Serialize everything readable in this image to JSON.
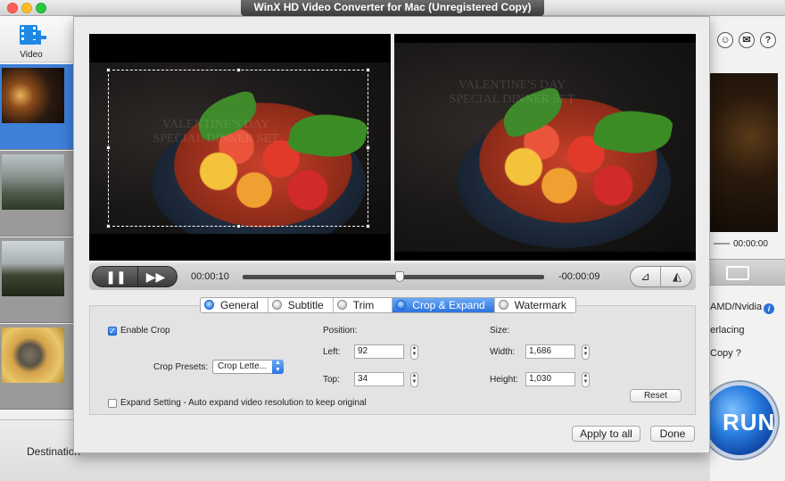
{
  "window": {
    "title": "WinX HD Video Converter for Mac (Unregistered Copy)"
  },
  "sidebar": {
    "video_label": "Video"
  },
  "right_panel": {
    "time": "00:00:00",
    "hw_label": "AMD/Nvidia",
    "deinterlace_label": "erlacing",
    "copy_label": "Copy ?",
    "run_label": "RUN"
  },
  "bottom": {
    "destination_label": "Destination"
  },
  "preview": {
    "watermark_line1": "VALENTINE'S DAY",
    "watermark_line2": "SPECIAL DINNER SET"
  },
  "playback": {
    "current_time": "00:00:10",
    "remaining_time": "-00:00:09",
    "progress": 0.52
  },
  "tabs": [
    {
      "label": "General",
      "active": false
    },
    {
      "label": "Subtitle",
      "active": false
    },
    {
      "label": "Trim",
      "active": false
    },
    {
      "label": "Crop & Expand",
      "active": true
    },
    {
      "label": "Watermark",
      "active": false
    }
  ],
  "crop": {
    "enable_label": "Enable Crop",
    "enabled": true,
    "presets_label": "Crop Presets:",
    "preset_value": "Crop Lette...",
    "position_label": "Position:",
    "left_label": "Left:",
    "left_value": "92",
    "top_label": "Top:",
    "top_value": "34",
    "size_label": "Size:",
    "width_label": "Width:",
    "width_value": "1,686",
    "height_label": "Height:",
    "height_value": "1,030",
    "reset_label": "Reset",
    "expand_label": "Expand Setting - Auto expand video resolution to keep original",
    "expand_enabled": false
  },
  "footer": {
    "apply_all_label": "Apply to all",
    "done_label": "Done"
  }
}
